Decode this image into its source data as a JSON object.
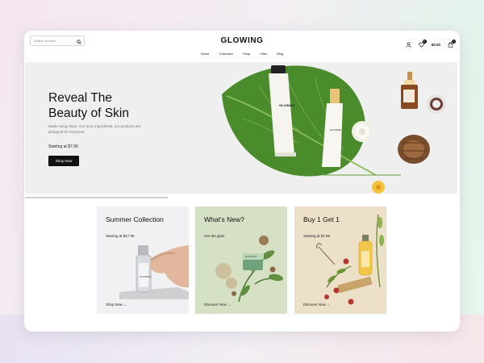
{
  "header": {
    "search_placeholder": "Search product",
    "logo": "GLOWING",
    "cart_total": "$0.00",
    "cart_count": "0",
    "wishlist_count": "0",
    "nav": [
      "Home",
      "Collection",
      "Shop",
      "Offer",
      "Blog"
    ]
  },
  "hero": {
    "title_line1": "Reveal The",
    "title_line2": "Beauty of Skin",
    "description": "Made using clean, non-toxic ingredients, our products are designed for everyone.",
    "price": "Starting at $7.99",
    "button": "Shop Now",
    "tube_label": "GLOWING",
    "bottle_label": "GLOWING",
    "slider_progress": 0.33
  },
  "cards": [
    {
      "title": "Summer Collection",
      "subtitle": "Starting at $17.99",
      "link": "Shop Now",
      "bottle_label": "GLOWING"
    },
    {
      "title": "What's New?",
      "subtitle": "Get the glow",
      "link": "Discover Now",
      "jar_label": "GLOWING"
    },
    {
      "title": "Buy 1 Get 1",
      "subtitle": "Starting at $7.99",
      "link": "Discover Now"
    }
  ]
}
